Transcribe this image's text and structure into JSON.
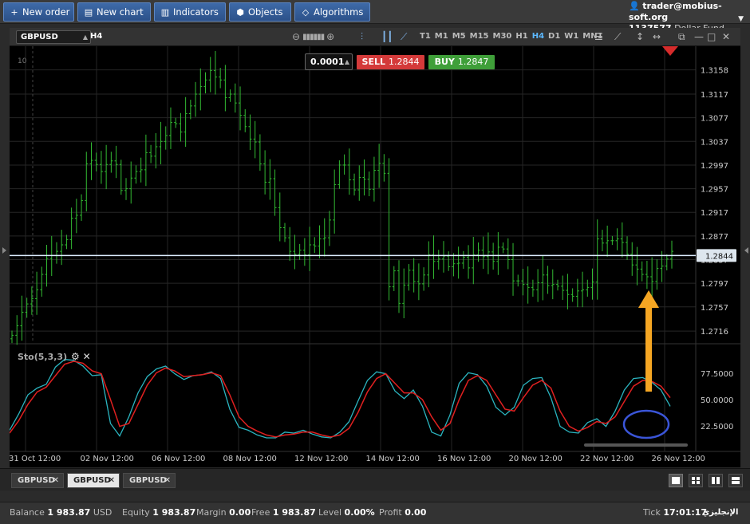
{
  "toolbar": {
    "new_order": "New order",
    "new_chart": "New chart",
    "indicators": "Indicators",
    "objects": "Objects",
    "algorithms": "Algorithms"
  },
  "account": {
    "user": "trader@mobius-soft.org",
    "number": "1137577",
    "fund": "Dollar Fund"
  },
  "chart_header": {
    "symbol": "GBPUSD",
    "timeframe": "H4",
    "timeframes": [
      "T1",
      "M1",
      "M5",
      "M15",
      "M30",
      "H1",
      "H4",
      "D1",
      "W1",
      "MN1"
    ],
    "active_timeframe": "H4"
  },
  "trade": {
    "step": "0.0001",
    "sell_label": "SELL",
    "sell_price": "1.2844",
    "buy_label": "BUY",
    "buy_price": "1.2847"
  },
  "indicator": {
    "label": "Sto(5,3,3)"
  },
  "chart_data": {
    "type": "candlestick-bar",
    "symbol": "GBPUSD",
    "y_ticks": [
      "1.3158",
      "1.3117",
      "1.3077",
      "1.3037",
      "1.2997",
      "1.2957",
      "1.2917",
      "1.2877",
      "1.2837",
      "1.2797",
      "1.2757",
      "1.2716"
    ],
    "ylim": [
      1.2696,
      1.3198
    ],
    "current_price": "1.2844",
    "corner_label": "10",
    "x_ticks": [
      "31 Oct 12:00",
      "02 Nov 12:00",
      "06 Nov 12:00",
      "08 Nov 12:00",
      "12 Nov 12:00",
      "14 Nov 12:00",
      "16 Nov 12:00",
      "20 Nov 12:00",
      "22 Nov 12:00",
      "26 Nov 12:00"
    ],
    "closes": [
      1.2709,
      1.2725,
      1.2748,
      1.2762,
      1.2771,
      1.2786,
      1.2812,
      1.2839,
      1.2844,
      1.2851,
      1.2862,
      1.2871,
      1.2907,
      1.2912,
      1.2937,
      1.2999,
      1.3005,
      1.2998,
      1.2986,
      1.2998,
      1.3004,
      1.2998,
      1.2954,
      1.2957,
      1.2975,
      1.2986,
      1.2989,
      1.3018,
      1.3012,
      1.3028,
      1.3037,
      1.3047,
      1.3069,
      1.3067,
      1.3053,
      1.3084,
      1.3097,
      1.3117,
      1.313,
      1.3141,
      1.3157,
      1.3146,
      1.3141,
      1.3111,
      1.3117,
      1.3102,
      1.3081,
      1.3062,
      1.3041,
      1.3036,
      1.2999,
      1.2968,
      1.2974,
      1.2925,
      1.2891,
      1.2874,
      1.2851,
      1.2846,
      1.2853,
      1.2845,
      1.2862,
      1.286,
      1.2872,
      1.2874,
      1.2904,
      1.2964,
      1.2997,
      1.2997,
      1.2972,
      1.2955,
      1.2976,
      1.2973,
      1.2956,
      1.2988,
      1.3,
      1.2983,
      1.2791,
      1.2818,
      1.2763,
      1.2794,
      1.2819,
      1.28,
      1.2796,
      1.2811,
      1.2845,
      1.2834,
      1.2838,
      1.2843,
      1.2825,
      1.283,
      1.2831,
      1.2841,
      1.2823,
      1.2845,
      1.2853,
      1.2842,
      1.285,
      1.2834,
      1.2858,
      1.2855,
      1.2837,
      1.2801,
      1.2801,
      1.2795,
      1.279,
      1.2786,
      1.2798,
      1.2811,
      1.2793,
      1.2795,
      1.2792,
      1.2785,
      1.2778,
      1.2775,
      1.2784,
      1.2786,
      1.279,
      1.2799,
      1.2872,
      1.2865,
      1.2869,
      1.2869,
      1.2872,
      1.2866,
      1.2846,
      1.2828,
      1.2821,
      1.2812,
      1.2808,
      1.28,
      1.2822,
      1.2826,
      1.2838,
      1.2851
    ],
    "stochastic": {
      "levels": [
        "77.5000",
        "50.0000",
        "22.5000"
      ],
      "k": [
        18,
        35,
        55,
        62,
        66,
        84,
        92,
        91,
        85,
        75,
        76,
        25,
        12,
        32,
        57,
        74,
        82,
        85,
        77,
        71,
        75,
        76,
        79,
        72,
        40,
        21,
        18,
        13,
        10,
        10,
        16,
        15,
        18,
        14,
        11,
        10,
        16,
        27,
        49,
        70,
        79,
        77,
        59,
        51,
        60,
        43,
        16,
        12,
        34,
        67,
        78,
        76,
        64,
        42,
        34,
        42,
        65,
        72,
        73,
        52,
        22,
        16,
        15,
        26,
        30,
        22,
        38,
        60,
        72,
        73,
        68,
        60,
        43
      ],
      "d": [
        15,
        28,
        45,
        58,
        63,
        75,
        87,
        90,
        88,
        80,
        77,
        50,
        22,
        25,
        45,
        65,
        78,
        83,
        80,
        74,
        75,
        76,
        78,
        75,
        55,
        32,
        22,
        17,
        13,
        11,
        13,
        14,
        16,
        16,
        13,
        11,
        13,
        20,
        37,
        58,
        72,
        77,
        67,
        57,
        57,
        50,
        32,
        18,
        25,
        50,
        70,
        75,
        70,
        55,
        40,
        38,
        52,
        65,
        70,
        62,
        38,
        22,
        17,
        21,
        27,
        25,
        32,
        48,
        64,
        70,
        69,
        64,
        52
      ]
    }
  },
  "tabs": [
    {
      "label": "GBPUSD",
      "active": false
    },
    {
      "label": "GBPUSD",
      "active": true
    },
    {
      "label": "GBPUSD",
      "active": false
    }
  ],
  "status": {
    "balance_label": "Balance",
    "balance_value": "1 983.87",
    "currency": "USD",
    "equity_label": "Equity",
    "equity_value": "1 983.87",
    "margin_label": "Margin",
    "margin_value": "0.00",
    "free_label": "Free",
    "free_value": "1 983.87",
    "level_label": "Level",
    "level_value": "0.00%",
    "profit_label": "Profit",
    "profit_value": "0.00",
    "tick_label": "Tick",
    "tick_value": "17:01:17",
    "locale_text": "الإنجليزي"
  },
  "colors": {
    "bar": "#33bb33",
    "k_line": "#2bb5c0",
    "d_line": "#e02020",
    "price_line": "#ddeeff",
    "arrow": "#f5a623",
    "circle": "#3a55d8"
  }
}
